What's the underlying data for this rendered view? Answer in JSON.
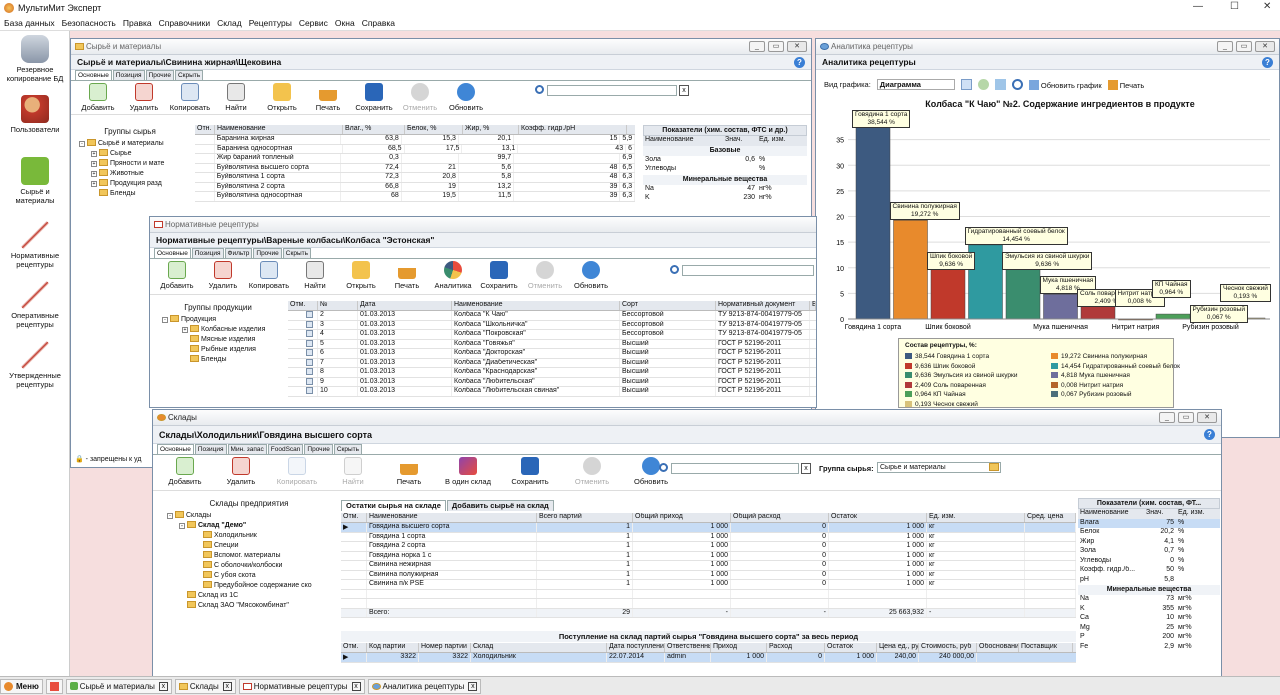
{
  "app": {
    "title": "МультиМит Эксперт",
    "menu": [
      "База данных",
      "Безопасность",
      "Правка",
      "Справочники",
      "Склад",
      "Рецептуры",
      "Сервис",
      "Окна",
      "Справка"
    ],
    "controls": {
      "min": "—",
      "max": "☐",
      "close": "✕"
    }
  },
  "sidebar": [
    {
      "label": "Резервное копирование БД"
    },
    {
      "label": "Пользователи"
    },
    {
      "label": "Сырьё и материалы"
    },
    {
      "label": "Нормативные рецептуры"
    },
    {
      "label": "Оперативные рецептуры"
    },
    {
      "label": "Утвержденные рецептуры"
    }
  ],
  "win_raw": {
    "title": "Сырьё и материалы",
    "path": "Сырьё и материалы\\Свинина жирная\\Щековина",
    "tabs": [
      "Основные",
      "Позиция",
      "Прочие",
      "Скрыть"
    ],
    "toolbar": [
      "Добавить",
      "Удалить",
      "Копировать",
      "Найти",
      "Открыть",
      "Печать",
      "Сохранить",
      "Отменить",
      "Обновить"
    ],
    "groups_title": "Группы сырья",
    "tree": [
      "Сырьё и материалы",
      "Сырье",
      "Пряности и мате",
      "Животные",
      "Продукция разд",
      "Бленды"
    ],
    "cols": [
      "Отн.",
      "Наименование",
      "Влаг., %",
      "Белок, %",
      "Жир, %",
      "Коэфф. гидр./рН"
    ],
    "rows": [
      [
        "Баранина жирная",
        "63,8",
        "15,3",
        "20,1",
        "15",
        "5,9"
      ],
      [
        "Баранина односортная",
        "68,5",
        "17,5",
        "13,1",
        "43",
        "6"
      ],
      [
        "Жир бараний топленый",
        "0,3",
        "",
        "99,7",
        "",
        "6,9"
      ],
      [
        "Буйволятина высшего сорта",
        "72,4",
        "21",
        "5,6",
        "48",
        "6,5"
      ],
      [
        "Буйволятина 1 сорта",
        "72,3",
        "20,8",
        "5,8",
        "48",
        "6,3"
      ],
      [
        "Буйволятина 2 сорта",
        "66,8",
        "19",
        "13,2",
        "39",
        "6,3"
      ],
      [
        "Буйволятина односортная",
        "68",
        "19,5",
        "11,5",
        "39",
        "6,3"
      ]
    ],
    "ind_title": "Показатели (хим. состав, ФТС и др.)",
    "ind_cols": [
      "Наименование",
      "Знач.",
      "Ед. изм."
    ],
    "ind": [
      {
        "sec": "Базовые"
      },
      {
        "n": "Зола",
        "v": "0,6",
        "u": "%"
      },
      {
        "n": "Углеводы",
        "v": "",
        "u": "%"
      },
      {
        "sec": "Минеральные вещества"
      },
      {
        "n": "Na",
        "v": "47",
        "u": "нг%"
      },
      {
        "n": "K",
        "v": "230",
        "u": "нг%"
      }
    ],
    "lock_text": "- запрещены к уд"
  },
  "win_norm": {
    "title": "Нормативные рецептуры",
    "path": "Нормативные рецептуры\\Вареные колбасы\\Колбаса \"Эстонская\"",
    "tabs": [
      "Основные",
      "Позиция",
      "Фильтр",
      "Прочие",
      "Скрыть"
    ],
    "toolbar": [
      "Добавить",
      "Удалить",
      "Копировать",
      "Найти",
      "Открыть",
      "Печать",
      "Аналитика",
      "Сохранить",
      "Отменить",
      "Обновить"
    ],
    "groups_title": "Группы продукции",
    "tree": [
      "Продукция",
      "Колбасные изделия",
      "Мясные изделия",
      "Рыбные изделия",
      "Бленды"
    ],
    "cols": [
      "Отм.",
      "№",
      "Дата",
      "Наименование",
      "Сорт",
      "Нормативный документ",
      "В"
    ],
    "rows": [
      [
        "2",
        "01.03.2013",
        "Колбаса \"К Чаю\"",
        "Бессортовой",
        "ТУ 9213-874-00419779-05"
      ],
      [
        "3",
        "01.03.2013",
        "Колбаса \"Школьничка\"",
        "Бессортовой",
        "ТУ 9213-874-00419779-05"
      ],
      [
        "4",
        "01.03.2013",
        "Колбаса \"Покровская\"",
        "Бессортовой",
        "ТУ 9213-874-00419779-05"
      ],
      [
        "5",
        "01.03.2013",
        "Колбаса \"Говяжья\"",
        "Высший",
        "ГОСТ Р 52196-2011"
      ],
      [
        "6",
        "01.03.2013",
        "Колбаса \"Докторская\"",
        "Высший",
        "ГОСТ Р 52196-2011"
      ],
      [
        "7",
        "01.03.2013",
        "Колбаса \"Диабетическая\"",
        "Высший",
        "ГОСТ Р 52196-2011"
      ],
      [
        "8",
        "01.03.2013",
        "Колбаса \"Краснодарская\"",
        "Высший",
        "ГОСТ Р 52196-2011"
      ],
      [
        "9",
        "01.03.2013",
        "Колбаса \"Любительская\"",
        "Высший",
        "ГОСТ Р 52196-2011"
      ],
      [
        "10",
        "01.03.2013",
        "Колбаса \"Любительская свиная\"",
        "Высший",
        "ГОСТ Р 52196-2011"
      ]
    ]
  },
  "win_chart": {
    "title": "Аналитика рецептуры",
    "path": "Аналитика рецептуры",
    "type_label": "Вид графика:",
    "type_value": "Диаграмма",
    "refresh": "Обновить график",
    "print": "Печать",
    "legend_title": "Состав рецептуры, %:",
    "legend": [
      {
        "t": "38,544 Говядина 1 сорта",
        "c": "#3d5a80"
      },
      {
        "t": "19,272 Свинина полужирная",
        "c": "#e88a2c"
      },
      {
        "t": "9,636 Шпик боковой",
        "c": "#c0392b"
      },
      {
        "t": "14,454 Гидратированный соевый белок",
        "c": "#2f9aa0"
      },
      {
        "t": "9,636 Эмульсия из свиной шкурки",
        "c": "#3a8d6e"
      },
      {
        "t": "4,818 Мука пшеничная",
        "c": "#6e6e9c"
      },
      {
        "t": "2,409 Соль поваренная",
        "c": "#b03a3a"
      },
      {
        "t": "0,008 Нитрит натрия",
        "c": "#b5652b"
      },
      {
        "t": "0,964 КП Чайная",
        "c": "#4c9f5a"
      },
      {
        "t": "0,067 Рубизин розовый",
        "c": "#4c6f7a"
      },
      {
        "t": "0,193 Чеснок свежий",
        "c": "#d8c27a"
      }
    ],
    "tick_labels": {
      "x": [
        "Говядина 1 сорта",
        "Шпик боковой",
        "Мука пшеничная",
        "Нитрит натрия",
        "Рубизин розовый"
      ],
      "y": [
        "0",
        "5",
        "10",
        "15",
        "20",
        "25",
        "30",
        "35"
      ]
    }
  },
  "chart_data": {
    "type": "bar",
    "title": "Колбаса \"К Чаю\" №2. Содержание ингредиентов в продукте",
    "xlabel": "",
    "ylabel": "",
    "ylim": [
      0,
      40
    ],
    "grid": true,
    "categories": [
      "Говядина 1 сорта",
      "Свинина полужирная",
      "Шпик боковой",
      "Гидратированный соевый белок",
      "Эмульсия из свиной шкурки",
      "Мука пшеничная",
      "Соль поваренная",
      "Нитрит натрия",
      "КП Чайная",
      "Рубизин розовый",
      "Чеснок свежий"
    ],
    "values": [
      38.544,
      19.272,
      9.636,
      14.454,
      9.636,
      4.818,
      2.409,
      0.008,
      0.964,
      0.067,
      0.193
    ],
    "data_labels": [
      "38,544 %",
      "19,272 %",
      "9,636 %",
      "14,454 %",
      "9,636 %",
      "4,818 %",
      "2,409 %",
      "0,008 %",
      "0,964 %",
      "0,067 %",
      "0,193 %"
    ],
    "colors": [
      "#3d5a80",
      "#e88a2c",
      "#c0392b",
      "#2f9aa0",
      "#3a8d6e",
      "#6e6e9c",
      "#b03a3a",
      "#b5652b",
      "#4c9f5a",
      "#4c6f7a",
      "#d8c27a"
    ]
  },
  "win_store": {
    "title": "Склады",
    "path": "Склады\\Холодильник\\Говядина высшего сорта",
    "tabs": [
      "Основные",
      "Позиция",
      "Мин. запас",
      "FoodScan",
      "Прочие",
      "Скрыть"
    ],
    "toolbar": [
      "Добавить",
      "Удалить",
      "Копировать",
      "Найти",
      "Печать",
      "В один склад",
      "Сохранить",
      "Отменить",
      "Обновить"
    ],
    "group_label": "Группа сырья:",
    "group_value": "Сырье и материалы",
    "tree_title": "Склады предприятия",
    "tree": [
      "Склады",
      "Склад \"Демо\"",
      "Холодильник",
      "Специи",
      "Вспомог. материалы",
      "С оболочки/колбоски",
      "С убоя скота",
      "Предубойное содержание ско",
      "Склад из 1С",
      "Склад ЗАО \"Мясокомбинат\""
    ],
    "subtabs": [
      "Остатки сырья на складе",
      "Добавить сырьё на склад"
    ],
    "cols": [
      "Отм.",
      "Наименование",
      "Всего партий",
      "Общий приход",
      "Общий расход",
      "Остаток",
      "Ед. изм.",
      "Сред. цена"
    ],
    "rows": [
      [
        "Говядина высшего сорта",
        "1",
        "1 000",
        "0",
        "1 000",
        "кг"
      ],
      [
        "Говядина 1 сорта",
        "1",
        "1 000",
        "0",
        "1 000",
        "кг"
      ],
      [
        "Говядина 2 сорта",
        "1",
        "1 000",
        "0",
        "1 000",
        "кг"
      ],
      [
        "Говядина норка 1 с",
        "1",
        "1 000",
        "0",
        "1 000",
        "кг"
      ],
      [
        "Свинина нежирная",
        "1",
        "1 000",
        "0",
        "1 000",
        "кг"
      ],
      [
        "Свинина полужирная",
        "1",
        "1 000",
        "0",
        "1 000",
        "кг"
      ],
      [
        "Свинина п/к PSE",
        "1",
        "1 000",
        "0",
        "1 000",
        "кг"
      ]
    ],
    "total": [
      "Всего:",
      "29",
      "-",
      "-",
      "25 663,932",
      "-"
    ],
    "party_title": "Поступление на склад партий сырья \"Говядина высшего сорта\" за весь период",
    "pcols": [
      "Отм.",
      "Код партии",
      "Номер партии",
      "Склад",
      "Дата поступления",
      "Ответственный",
      "Приход",
      "Расход",
      "Остаток",
      "Цена ед., руб.",
      "Стоимость, руб",
      "Обоснование",
      "Поставщик"
    ],
    "prow": [
      "3322",
      "3322",
      "Холодильник",
      "22.07.2014",
      "admin",
      "1 000",
      "0",
      "1 000",
      "240,00",
      "240 000,00"
    ],
    "ind_title": "Показатели (хим. состав, ФТ...",
    "ind_cols": [
      "Наименование",
      "Знач.",
      "Ед. изм."
    ],
    "ind": [
      {
        "n": "Влага",
        "v": "75",
        "u": "%"
      },
      {
        "n": "Белок",
        "v": "20,2",
        "u": "%"
      },
      {
        "n": "Жир",
        "v": "4,1",
        "u": "%"
      },
      {
        "n": "Зола",
        "v": "0,7",
        "u": "%"
      },
      {
        "n": "Углеводы",
        "v": "0",
        "u": "%"
      },
      {
        "n": "Коэфф. гидр./б...",
        "v": "50",
        "u": "%"
      },
      {
        "n": "pH",
        "v": "5,8",
        "u": ""
      },
      {
        "sec": "Минеральные вещества"
      },
      {
        "n": "Na",
        "v": "73",
        "u": "мг%"
      },
      {
        "n": "K",
        "v": "355",
        "u": "мг%"
      },
      {
        "n": "Ca",
        "v": "10",
        "u": "мг%"
      },
      {
        "n": "Mg",
        "v": "25",
        "u": "мг%"
      },
      {
        "n": "P",
        "v": "200",
        "u": "мг%"
      },
      {
        "n": "Fe",
        "v": "2,9",
        "u": "мг%"
      }
    ]
  },
  "taskbar": {
    "menu": "Меню",
    "items": [
      "Сырьё и материалы",
      "Склады",
      "Нормативные рецептуры",
      "Аналитика рецептуры"
    ]
  }
}
